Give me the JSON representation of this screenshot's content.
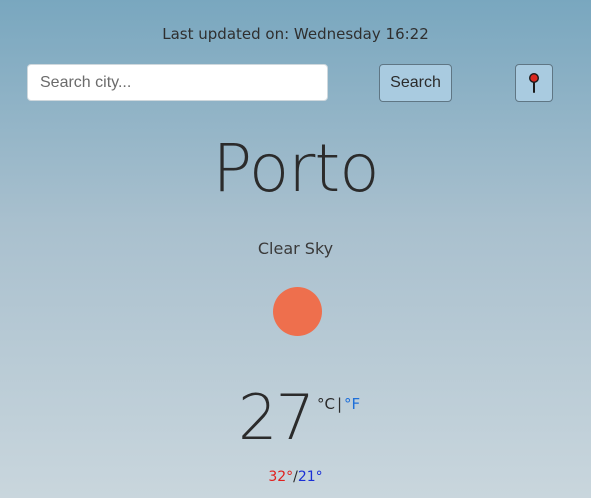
{
  "header": {
    "last_updated": "Last updated on: Wednesday 16:22"
  },
  "search": {
    "placeholder": "Search city...",
    "value": "",
    "button_label": "Search",
    "location_icon": "map-pin-icon"
  },
  "weather": {
    "city": "Porto",
    "description": "Clear Sky",
    "icon": "sun-icon",
    "temperature": "27",
    "unit_celsius": "°C",
    "unit_separator": "|",
    "unit_fahrenheit": "°F",
    "max": "32°",
    "separator": "/",
    "min": "21°"
  },
  "colors": {
    "sun": "#ee6f4d",
    "max_temp": "#e0201e",
    "min_temp": "#1a2fd6",
    "link": "#1e6fd9",
    "button_bg": "#a9cbe0"
  }
}
